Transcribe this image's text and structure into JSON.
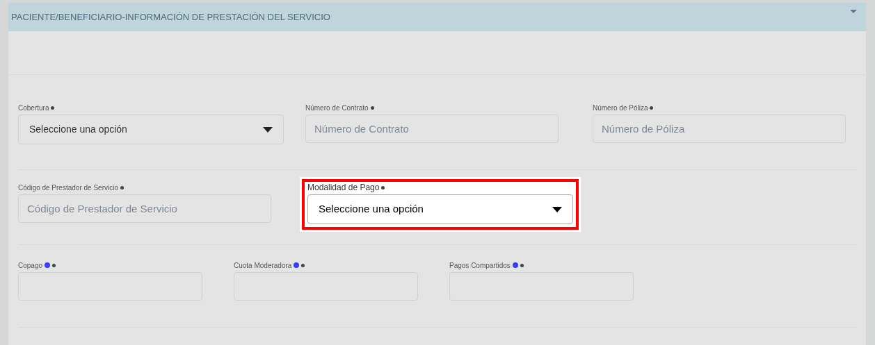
{
  "panel": {
    "title": "PACIENTE/BENEFICIARIO-INFORMACIÓN DE PRESTACIÓN DEL SERVICIO",
    "expanded": true
  },
  "rows": [
    [
      {
        "kind": "select",
        "label": "Cobertura",
        "required": true,
        "info": false,
        "highlighted": false,
        "value": "Seleccione una opción"
      },
      {
        "kind": "text",
        "label": "Número de Contrato",
        "required": true,
        "info": false,
        "highlighted": false,
        "placeholder": "Número de Contrato"
      },
      {
        "kind": "text",
        "label": "Número de Póliza",
        "required": true,
        "info": false,
        "highlighted": false,
        "placeholder": "Número de Póliza"
      }
    ],
    [
      {
        "kind": "text",
        "label": "Código de Prestador de Servicio",
        "required": true,
        "info": false,
        "highlighted": false,
        "placeholder": "Código de Prestador de Servicio"
      },
      {
        "kind": "select",
        "label": "Modalidad de Pago",
        "required": true,
        "info": false,
        "highlighted": true,
        "value": "Seleccione una opción"
      }
    ],
    [
      {
        "kind": "text",
        "label": "Copago",
        "required": true,
        "info": true,
        "highlighted": false
      },
      {
        "kind": "text",
        "label": "Cuota Moderadora",
        "required": true,
        "info": true,
        "highlighted": false
      },
      {
        "kind": "text",
        "label": "Pagos Compartidos",
        "required": true,
        "info": true,
        "highlighted": false
      }
    ]
  ]
}
